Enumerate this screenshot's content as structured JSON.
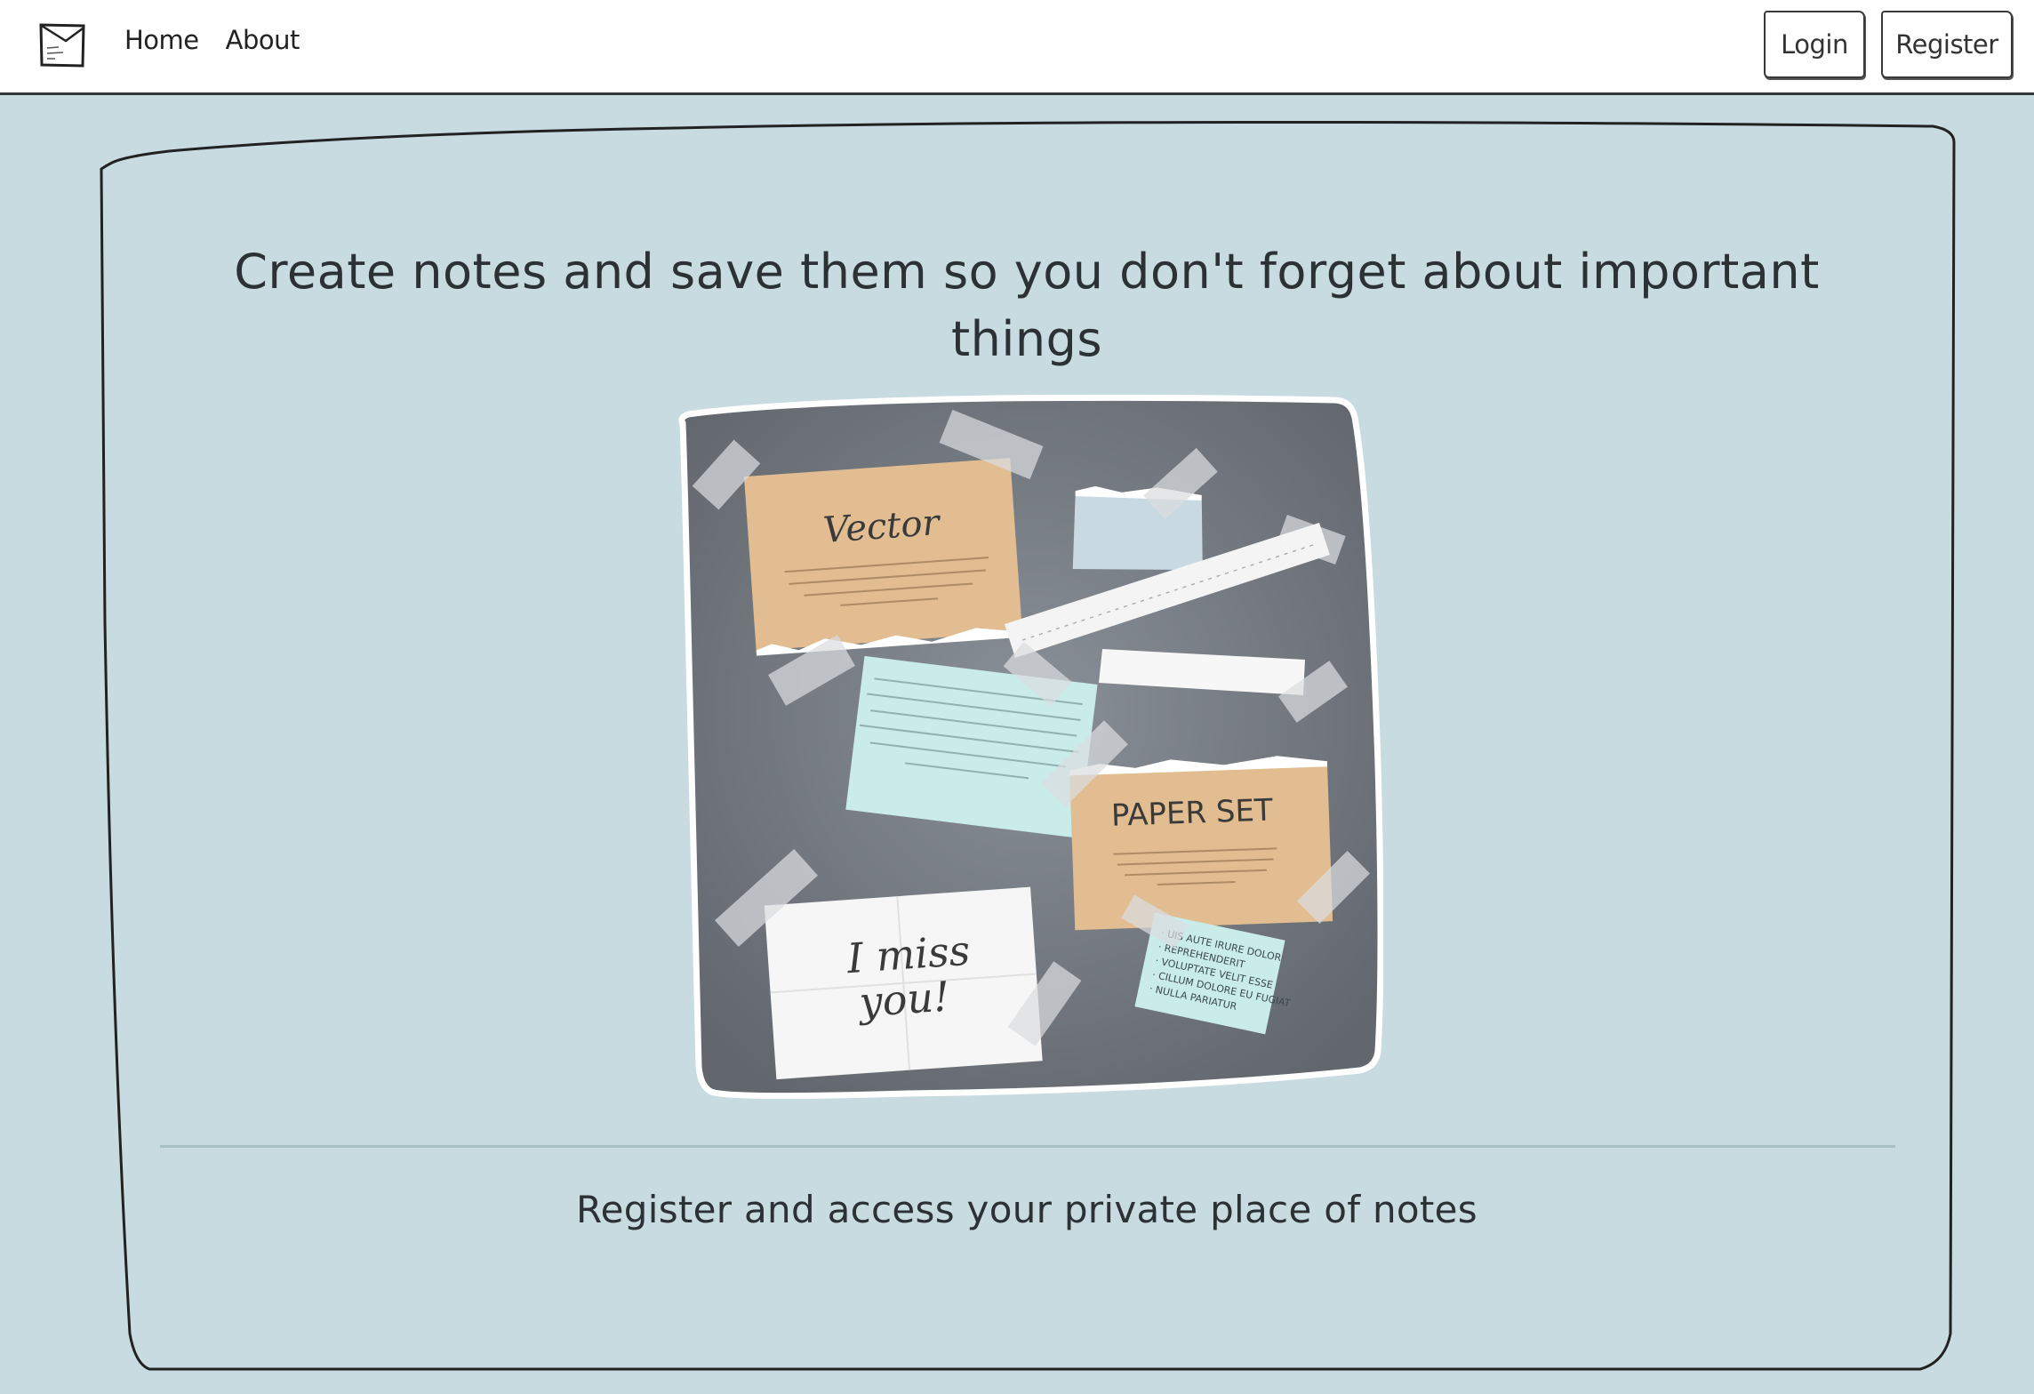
{
  "nav": {
    "logo_icon": "sticky-note-logo-icon",
    "links": [
      "Home",
      "About"
    ],
    "login_label": "Login",
    "register_label": "Register"
  },
  "main": {
    "headline": "Create notes and save them so you don't forget about important things",
    "tagline": "Register and access your private place of notes"
  },
  "illustration": {
    "note_vector": "Vector",
    "note_miss_line1": "I miss",
    "note_miss_line2": "you!",
    "note_paper_set": "PAPER SET",
    "note_list": [
      "· UIS AUTE IRURE DOLOR",
      "· REPREHENDERIT",
      "· VOLUPTATE VELIT ESSE",
      "· CILLUM DOLORE EU FUGIAT",
      "· NULLA PARIATUR"
    ]
  },
  "colors": {
    "background": "#c7dbe0",
    "navbar": "#ffffff",
    "board": "#6b7077",
    "kraft_note": "#e2bd92",
    "mint_note": "#c9ece9",
    "tape": "#d9dcdf"
  }
}
